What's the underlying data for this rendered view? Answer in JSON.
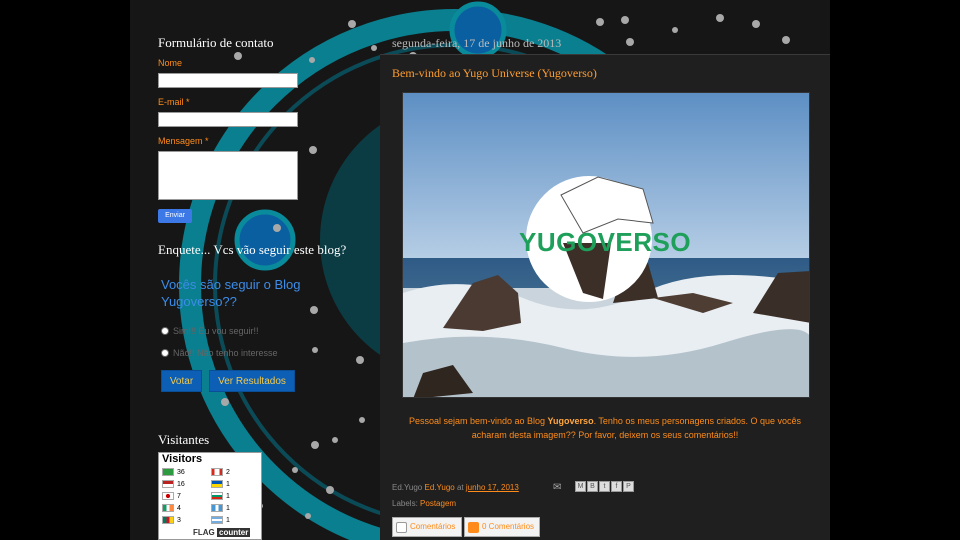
{
  "contact_form": {
    "title": "Formulário de contato",
    "name_label": "Nome",
    "email_label": "E-mail *",
    "message_label": "Mensagem *",
    "send_label": "Enviar"
  },
  "poll": {
    "title": "Enquete... Vcs vão seguir este blog?",
    "question_line1": "Vocês são seguir o Blog",
    "question_line2": "Yugoverso??",
    "option1": "Sim!!! Eu vou seguir!!",
    "option2": "Não!! Não tenho interesse",
    "vote_label": "Votar",
    "results_label": "Ver Resultados"
  },
  "visitors": {
    "title": "Visitantes",
    "widget_title": "Visitors",
    "rows_left": [
      {
        "count": "36",
        "flag": "brazil"
      },
      {
        "count": "16",
        "flag": "usa"
      },
      {
        "count": "7",
        "flag": "japan"
      },
      {
        "count": "4",
        "flag": "ireland"
      },
      {
        "count": "3",
        "flag": "cameroon"
      }
    ],
    "rows_right": [
      {
        "count": "2",
        "flag": "canada"
      },
      {
        "count": "1",
        "flag": "ukraine"
      },
      {
        "count": "1",
        "flag": "bulgaria"
      },
      {
        "count": "1",
        "flag": "guatemala"
      },
      {
        "count": "1",
        "flag": "argentina"
      }
    ],
    "flag_text": "FLAG",
    "counter_text": "counter"
  },
  "post": {
    "date": "segunda-feira, 17 de junho de 2013",
    "title": "Bem-vindo ao Yugo Universe (Yugoverso)",
    "image_logo": "YUGOVERSO",
    "body_prefix": "Pessoal sejam bem-vindo ao Blog ",
    "body_bold": "Yugoverso",
    "body_suffix": ". Tenho os meus personagens criados. O que vocês acharam desta imagem?? Por favor, deixem os seus comentários!!",
    "author_prefix": "Ed.Yugo",
    "author_link": "Ed.Yugo",
    "at": "at",
    "time": "junho 17, 2013",
    "labels_prefix": "Labels:",
    "label": "Postagem",
    "comments_label": "Comentários",
    "comments_count_label": "0 Comentários"
  },
  "colors": {
    "accent": "#ff8c1a",
    "link_blue": "#3c8ce8",
    "ring_teal": "#0a8b9b"
  }
}
